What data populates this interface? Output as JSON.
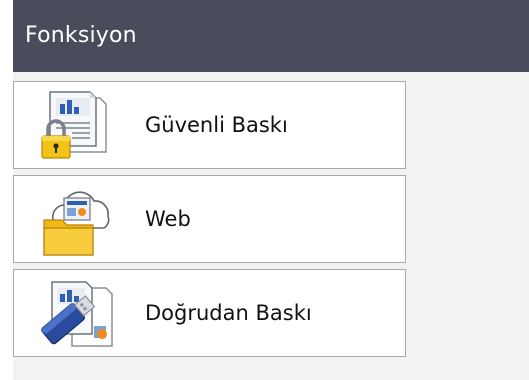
{
  "header": {
    "title": "Fonksiyon"
  },
  "menu": {
    "items": [
      {
        "label": "Güvenli Baskı",
        "icon": "secure-print-icon"
      },
      {
        "label": "Web",
        "icon": "web-connect-icon"
      },
      {
        "label": "Doğrudan Baskı",
        "icon": "usb-direct-print-icon"
      }
    ]
  },
  "colors": {
    "header_bg": "#4a4c5c",
    "screen_bg": "#f2f2f3",
    "button_bg": "#ffffff",
    "button_border": "#a9a9ad"
  }
}
